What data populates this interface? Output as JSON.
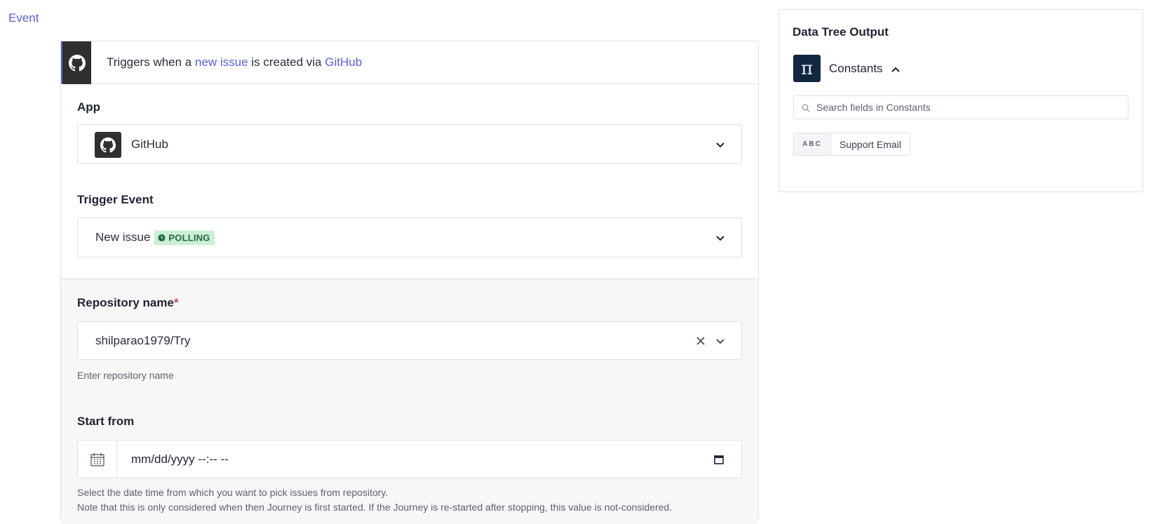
{
  "header": {
    "event_tab": "Event"
  },
  "trigger_bar": {
    "prefix": "Triggers when a",
    "event_link": "new issue",
    "middle": "is created via",
    "app_link": "GitHub",
    "icon": "github-icon"
  },
  "app": {
    "label": "App",
    "value": "GitHub",
    "icon": "github-icon"
  },
  "trigger_event": {
    "label": "Trigger Event",
    "value": "New issue",
    "badge": "POLLING"
  },
  "repository": {
    "label": "Repository name",
    "required_mark": "*",
    "value": "shilparao1979/Try",
    "helper": "Enter repository name"
  },
  "start_from": {
    "label": "Start from",
    "value": "mm/dd/yyyy --:-- --",
    "helper_line1": "Select the date time from which you want to pick issues from repository.",
    "helper_line2": "Note that this is only considered when then Journey is first started. If the Journey is re-started after stopping, this value is not-considered."
  },
  "data_tree": {
    "title": "Data Tree Output",
    "source_label": "Constants",
    "source_icon": "pi-icon",
    "search_placeholder": "Search fields in Constants",
    "fields": [
      {
        "type": "ABC",
        "name": "Support Email"
      }
    ]
  },
  "colors": {
    "accent": "#5b60d0",
    "badge_bg": "#cdeed6",
    "badge_text": "#1e6b3a",
    "required": "#d64545",
    "dark_icon_bg": "#2f2f2f",
    "constants_icon_bg": "#12263f"
  }
}
